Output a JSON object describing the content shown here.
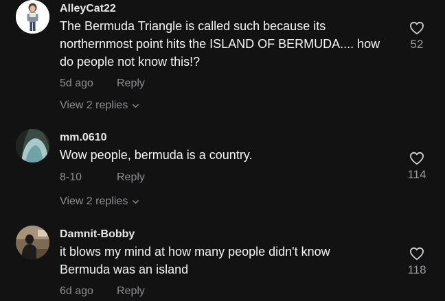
{
  "comments": [
    {
      "username": "AlleyCat22",
      "text": "The Bermuda Triangle is called such because its northernmost point hits the ISLAND OF BERMUDA.... how do people not know this!?",
      "date": "5d ago",
      "reply_label": "Reply",
      "view_replies_label": "View 2 replies",
      "likes": "52",
      "avatar": "person-standing-avatar"
    },
    {
      "username": "mm.0610",
      "text": "Wow people, bermuda is a country.",
      "date": "8-10",
      "reply_label": "Reply",
      "view_replies_label": "View 2 replies",
      "likes": "114",
      "avatar": "cave-landscape-avatar"
    },
    {
      "username": "Damnit-Bobby",
      "text": "it blows my mind at how many people didn't know Bermuda was an island",
      "date": "6d ago",
      "reply_label": "Reply",
      "likes": "118",
      "avatar": "person-seated-avatar"
    }
  ],
  "colors": {
    "background": "#121212",
    "primary_text": "#f5f5f5",
    "secondary_text": "#8e8e93"
  },
  "icons": [
    "heart-outline-icon",
    "chevron-down-icon"
  ]
}
